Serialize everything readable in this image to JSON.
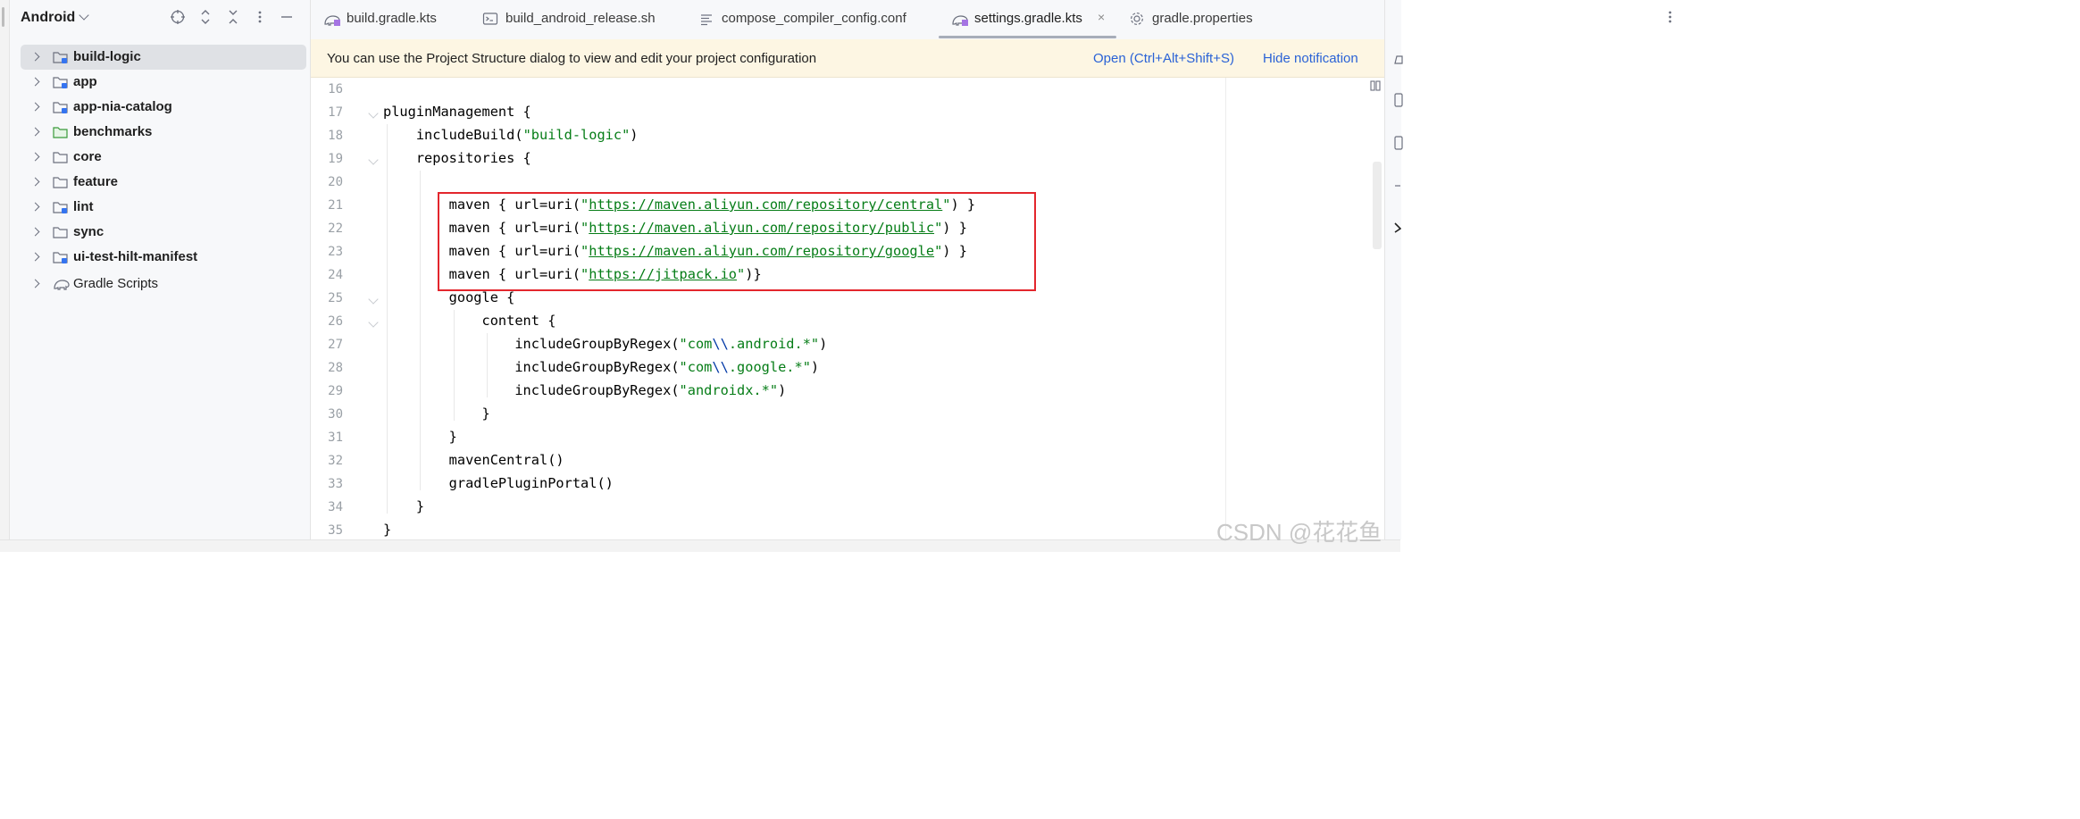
{
  "project_panel": {
    "title": "Android",
    "items": [
      {
        "label": "build-logic",
        "selected": true
      },
      {
        "label": "app"
      },
      {
        "label": "app-nia-catalog"
      },
      {
        "label": "benchmarks"
      },
      {
        "label": "core"
      },
      {
        "label": "feature"
      },
      {
        "label": "lint"
      },
      {
        "label": "sync"
      },
      {
        "label": "ui-test-hilt-manifest"
      },
      {
        "label": "Gradle Scripts"
      }
    ]
  },
  "tabs": [
    {
      "label": "build.gradle.kts",
      "icon": "gradle-kts-icon"
    },
    {
      "label": "build_android_release.sh",
      "icon": "terminal-script-icon"
    },
    {
      "label": "compose_compiler_config.conf",
      "icon": "text-file-icon"
    },
    {
      "label": "settings.gradle.kts",
      "icon": "gradle-kts-icon",
      "active": true,
      "close": "×"
    },
    {
      "label": "gradle.properties",
      "icon": "gear-icon"
    }
  ],
  "notification": {
    "text": "You can use the Project Structure dialog to view and edit your project configuration",
    "open_link": "Open (Ctrl+Alt+Shift+S)",
    "hide_link": "Hide notification"
  },
  "editor": {
    "line_numbers": [
      "16",
      "17",
      "18",
      "19",
      "20",
      "21",
      "22",
      "23",
      "24",
      "25",
      "26",
      "27",
      "28",
      "29",
      "30",
      "31",
      "32",
      "33",
      "34",
      "35"
    ]
  },
  "colors": {
    "highlight_box": "#e3262d",
    "string": "#067d17",
    "link": "#2a62d6",
    "notification_bg": "#fdf6e3"
  },
  "watermark": "CSDN @花花鱼"
}
